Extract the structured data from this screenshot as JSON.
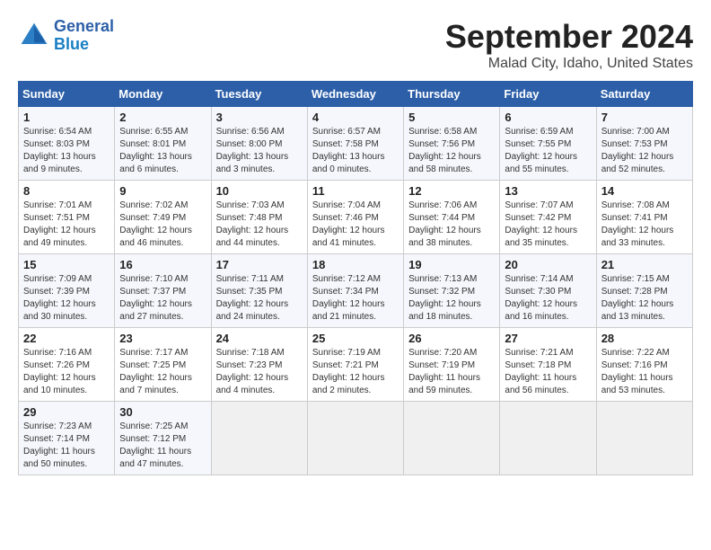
{
  "header": {
    "logo_text_line1": "General",
    "logo_text_line2": "Blue",
    "month_title": "September 2024",
    "location": "Malad City, Idaho, United States"
  },
  "weekdays": [
    "Sunday",
    "Monday",
    "Tuesday",
    "Wednesday",
    "Thursday",
    "Friday",
    "Saturday"
  ],
  "weeks": [
    [
      {
        "day": "1",
        "sunrise": "6:54 AM",
        "sunset": "8:03 PM",
        "daylight": "13 hours and 9 minutes."
      },
      {
        "day": "2",
        "sunrise": "6:55 AM",
        "sunset": "8:01 PM",
        "daylight": "13 hours and 6 minutes."
      },
      {
        "day": "3",
        "sunrise": "6:56 AM",
        "sunset": "8:00 PM",
        "daylight": "13 hours and 3 minutes."
      },
      {
        "day": "4",
        "sunrise": "6:57 AM",
        "sunset": "7:58 PM",
        "daylight": "13 hours and 0 minutes."
      },
      {
        "day": "5",
        "sunrise": "6:58 AM",
        "sunset": "7:56 PM",
        "daylight": "12 hours and 58 minutes."
      },
      {
        "day": "6",
        "sunrise": "6:59 AM",
        "sunset": "7:55 PM",
        "daylight": "12 hours and 55 minutes."
      },
      {
        "day": "7",
        "sunrise": "7:00 AM",
        "sunset": "7:53 PM",
        "daylight": "12 hours and 52 minutes."
      }
    ],
    [
      {
        "day": "8",
        "sunrise": "7:01 AM",
        "sunset": "7:51 PM",
        "daylight": "12 hours and 49 minutes."
      },
      {
        "day": "9",
        "sunrise": "7:02 AM",
        "sunset": "7:49 PM",
        "daylight": "12 hours and 46 minutes."
      },
      {
        "day": "10",
        "sunrise": "7:03 AM",
        "sunset": "7:48 PM",
        "daylight": "12 hours and 44 minutes."
      },
      {
        "day": "11",
        "sunrise": "7:04 AM",
        "sunset": "7:46 PM",
        "daylight": "12 hours and 41 minutes."
      },
      {
        "day": "12",
        "sunrise": "7:06 AM",
        "sunset": "7:44 PM",
        "daylight": "12 hours and 38 minutes."
      },
      {
        "day": "13",
        "sunrise": "7:07 AM",
        "sunset": "7:42 PM",
        "daylight": "12 hours and 35 minutes."
      },
      {
        "day": "14",
        "sunrise": "7:08 AM",
        "sunset": "7:41 PM",
        "daylight": "12 hours and 33 minutes."
      }
    ],
    [
      {
        "day": "15",
        "sunrise": "7:09 AM",
        "sunset": "7:39 PM",
        "daylight": "12 hours and 30 minutes."
      },
      {
        "day": "16",
        "sunrise": "7:10 AM",
        "sunset": "7:37 PM",
        "daylight": "12 hours and 27 minutes."
      },
      {
        "day": "17",
        "sunrise": "7:11 AM",
        "sunset": "7:35 PM",
        "daylight": "12 hours and 24 minutes."
      },
      {
        "day": "18",
        "sunrise": "7:12 AM",
        "sunset": "7:34 PM",
        "daylight": "12 hours and 21 minutes."
      },
      {
        "day": "19",
        "sunrise": "7:13 AM",
        "sunset": "7:32 PM",
        "daylight": "12 hours and 18 minutes."
      },
      {
        "day": "20",
        "sunrise": "7:14 AM",
        "sunset": "7:30 PM",
        "daylight": "12 hours and 16 minutes."
      },
      {
        "day": "21",
        "sunrise": "7:15 AM",
        "sunset": "7:28 PM",
        "daylight": "12 hours and 13 minutes."
      }
    ],
    [
      {
        "day": "22",
        "sunrise": "7:16 AM",
        "sunset": "7:26 PM",
        "daylight": "12 hours and 10 minutes."
      },
      {
        "day": "23",
        "sunrise": "7:17 AM",
        "sunset": "7:25 PM",
        "daylight": "12 hours and 7 minutes."
      },
      {
        "day": "24",
        "sunrise": "7:18 AM",
        "sunset": "7:23 PM",
        "daylight": "12 hours and 4 minutes."
      },
      {
        "day": "25",
        "sunrise": "7:19 AM",
        "sunset": "7:21 PM",
        "daylight": "12 hours and 2 minutes."
      },
      {
        "day": "26",
        "sunrise": "7:20 AM",
        "sunset": "7:19 PM",
        "daylight": "11 hours and 59 minutes."
      },
      {
        "day": "27",
        "sunrise": "7:21 AM",
        "sunset": "7:18 PM",
        "daylight": "11 hours and 56 minutes."
      },
      {
        "day": "28",
        "sunrise": "7:22 AM",
        "sunset": "7:16 PM",
        "daylight": "11 hours and 53 minutes."
      }
    ],
    [
      {
        "day": "29",
        "sunrise": "7:23 AM",
        "sunset": "7:14 PM",
        "daylight": "11 hours and 50 minutes."
      },
      {
        "day": "30",
        "sunrise": "7:25 AM",
        "sunset": "7:12 PM",
        "daylight": "11 hours and 47 minutes."
      },
      null,
      null,
      null,
      null,
      null
    ]
  ]
}
